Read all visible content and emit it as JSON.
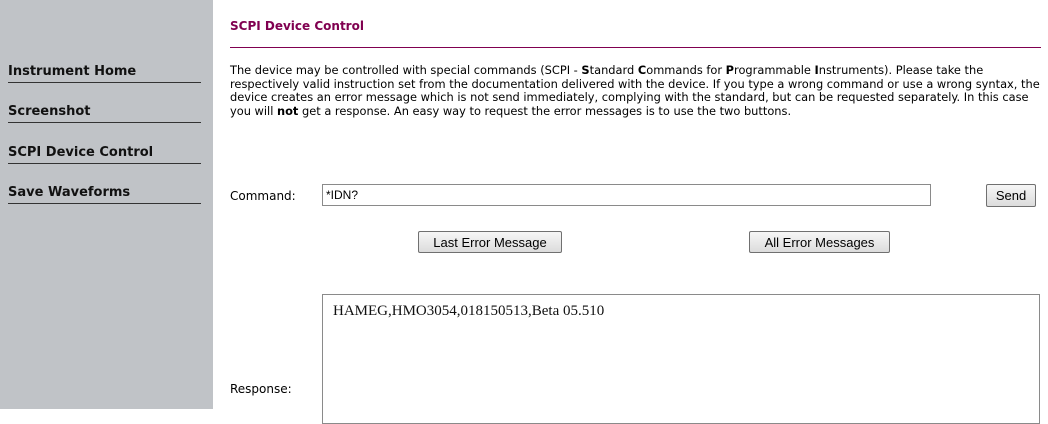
{
  "sidebar": {
    "items": [
      {
        "label": "Instrument Home"
      },
      {
        "label": "Screenshot"
      },
      {
        "label": "SCPI Device Control"
      },
      {
        "label": "Save Waveforms"
      }
    ]
  },
  "main": {
    "title": "SCPI Device Control",
    "intro": {
      "p1": "The device may be controlled with special commands (SCPI - ",
      "s": "S",
      "p2": "tandard ",
      "c": "C",
      "p3": "ommands for ",
      "p": "P",
      "p4": "rogrammable ",
      "i": "I",
      "p5": "nstruments). Please take the respectively valid instruction set from the documentation delivered with the device. If you type a wrong command or use a wrong syntax, the device creates an error message which is not send immediately, complying with the standard, but can be requested separately. In this case you will ",
      "not": "not",
      "p6": " get a response. An easy way to request the error messages is to use the two buttons."
    },
    "command_label": "Command:",
    "command_value": "*IDN?",
    "send_label": "Send",
    "last_error_label": "Last Error Message",
    "all_errors_label": "All Error Messages",
    "response_label": "Response:",
    "response_value": "HAMEG,HMO3054,018150513,Beta 05.510"
  }
}
